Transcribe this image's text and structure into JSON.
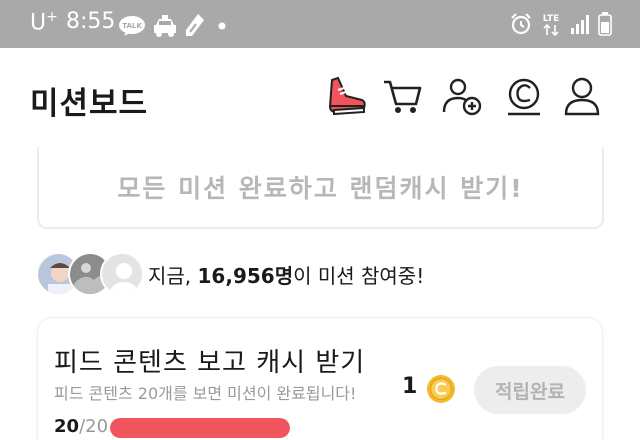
{
  "status_bar": {
    "carrier": "U",
    "carrier_sup": "+",
    "time": "8:55",
    "talk_label": "TALK",
    "lte_label": "LTE",
    "icons": [
      "kakaotalk-icon",
      "taxi-icon",
      "figure-icon",
      "dot-icon",
      "alarm-icon",
      "lte-icon",
      "signal-icon",
      "battery-icon"
    ]
  },
  "header": {
    "title": "미션보드",
    "icons": [
      "sneaker-icon",
      "cart-icon",
      "add-friend-icon",
      "cash-coin-icon",
      "profile-icon"
    ]
  },
  "banner": {
    "text": "모든 미션 완료하고 랜덤캐시 받기!"
  },
  "participants": {
    "prefix": "지금, ",
    "count": "16,956명",
    "suffix": "이 미션 참여중!"
  },
  "mission_card": {
    "title": "피드 콘텐츠 보고 캐시 받기",
    "description": "피드 콘텐츠 20개를 보면 미션이 완료됩니다!",
    "reward": "1",
    "button": "적립완료",
    "progress_current": "20",
    "progress_total": "/20",
    "progress_fraction": 1.0
  },
  "colors": {
    "status_bar": "#a9a9a9",
    "progress": "#f0545c",
    "coin": "#f5b82e",
    "sneaker": "#f0545c"
  }
}
